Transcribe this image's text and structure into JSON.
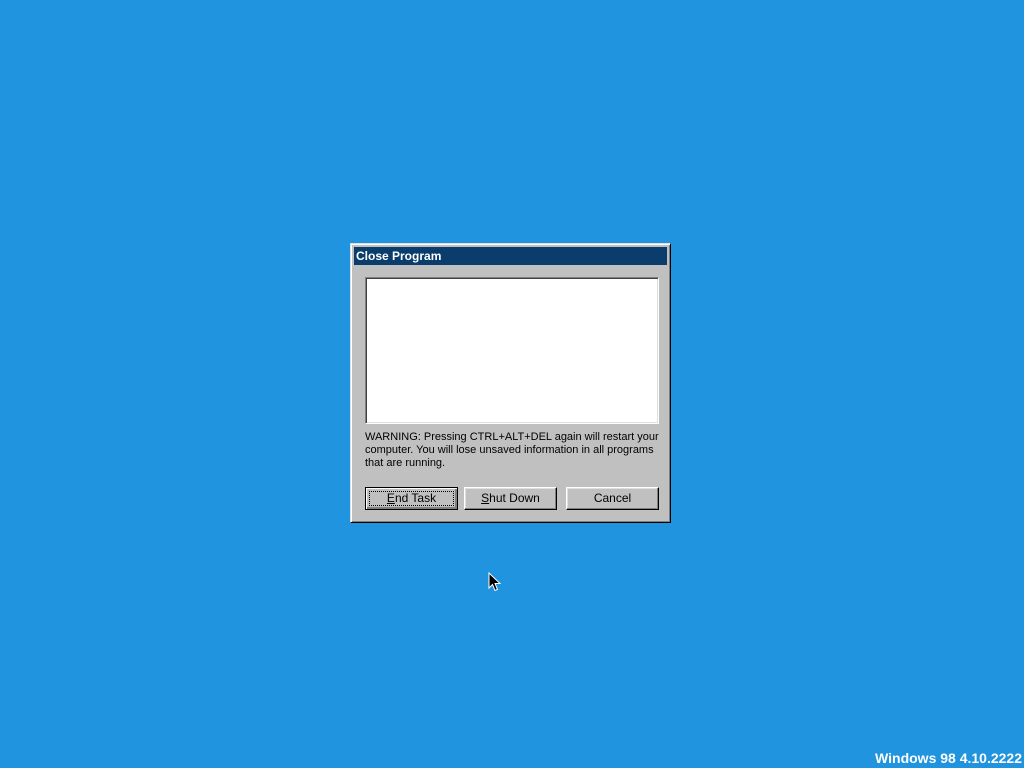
{
  "dialog": {
    "title": "Close Program",
    "program_list": [],
    "warning": "WARNING: Pressing CTRL+ALT+DEL again will restart your computer. You will lose unsaved information in all programs that are running.",
    "buttons": {
      "end_task": {
        "prefix": "",
        "mnemonic": "E",
        "rest": "nd Task"
      },
      "shut_down": {
        "prefix": "",
        "mnemonic": "S",
        "rest": "hut Down"
      },
      "cancel": {
        "label": "Cancel"
      }
    },
    "default_button": "end_task"
  },
  "desktop": {
    "version_text": "Windows 98 4.10.2222",
    "background_color": "#2094de"
  },
  "cursor": {
    "icon": "arrow-cursor-icon"
  },
  "colors": {
    "titlebar": "#0a3d6b",
    "face": "#c0c0c0"
  }
}
